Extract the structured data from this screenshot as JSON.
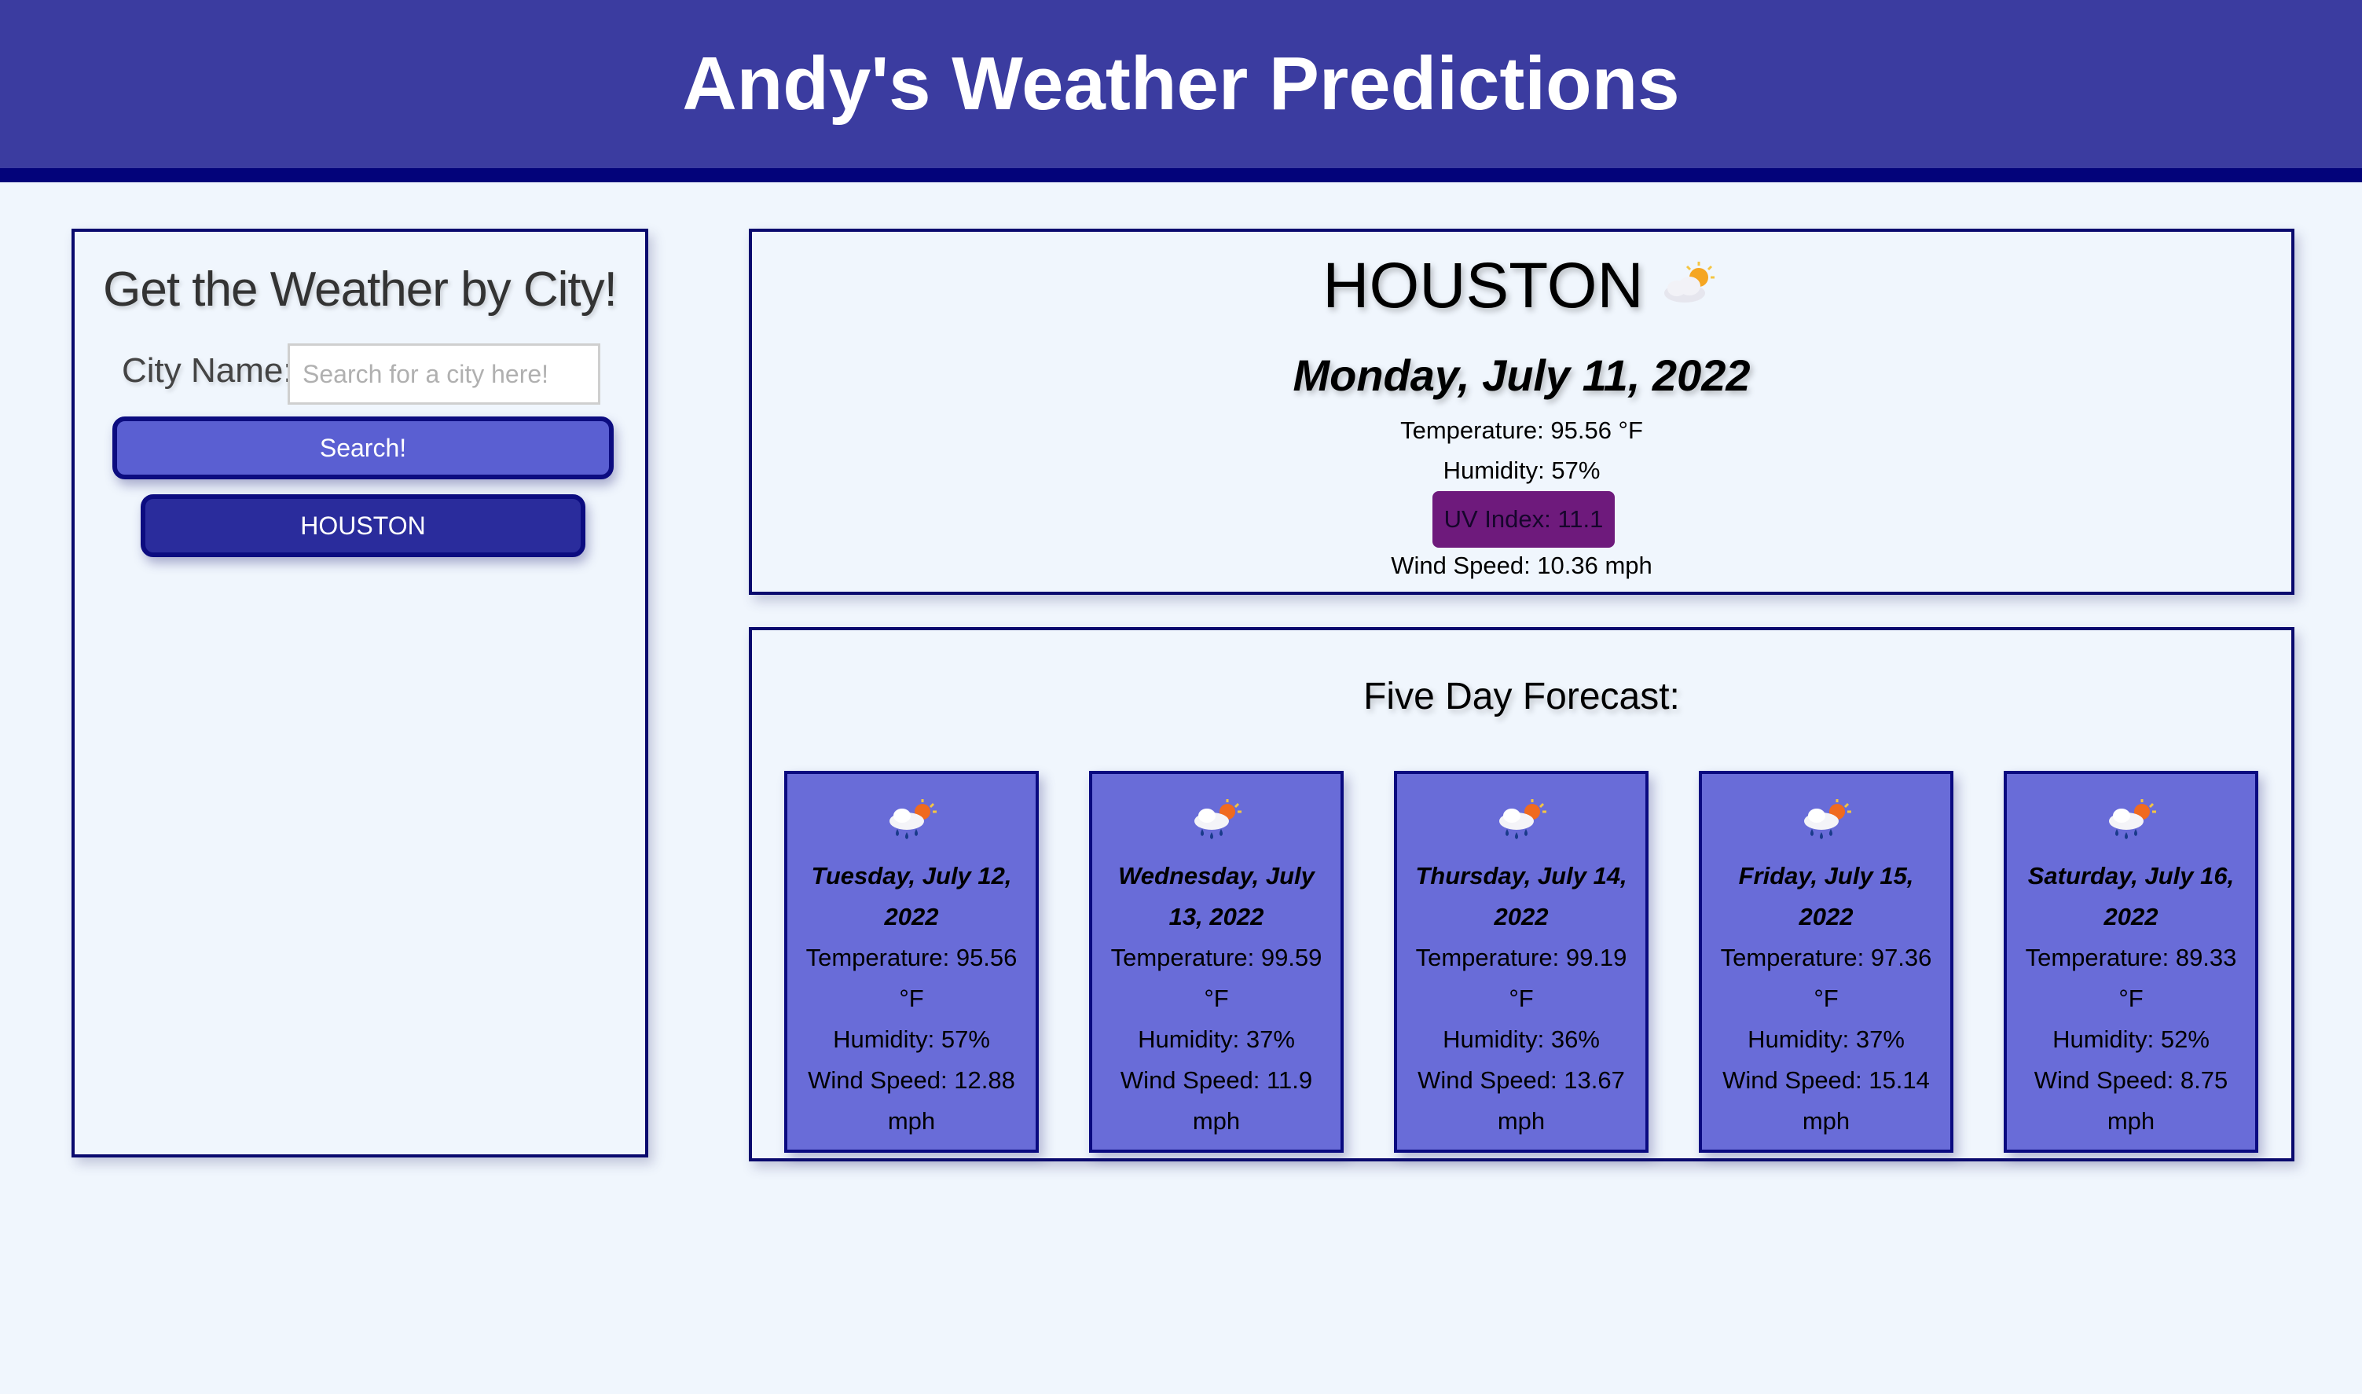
{
  "header": {
    "title": "Andy's Weather Predictions"
  },
  "search": {
    "title": "Get the Weather by City!",
    "city_label": "City Name:",
    "placeholder": "Search for a city here!",
    "value": "",
    "button_label": "Search!",
    "history": [
      "HOUSTON"
    ]
  },
  "current": {
    "city": "HOUSTON",
    "icon": "partly-cloudy-icon",
    "date": "Monday, July 11, 2022",
    "temperature": "Temperature: 95.56 °F",
    "humidity": "Humidity: 57%",
    "uv_index": "UV Index: 11.1",
    "wind": "Wind Speed: 10.36 mph",
    "uv_color": "#6e1a7c"
  },
  "forecast": {
    "title": "Five Day Forecast:",
    "days": [
      {
        "date": "Tuesday, July 12, 2022",
        "icon": "rain-sun-icon",
        "temperature": "Temperature: 95.56 °F",
        "humidity": "Humidity: 57%",
        "wind": "Wind Speed: 12.88 mph"
      },
      {
        "date": "Wednesday, July 13, 2022",
        "icon": "rain-sun-icon",
        "temperature": "Temperature: 99.59 °F",
        "humidity": "Humidity: 37%",
        "wind": "Wind Speed: 11.9 mph"
      },
      {
        "date": "Thursday, July 14, 2022",
        "icon": "rain-sun-icon",
        "temperature": "Temperature: 99.19 °F",
        "humidity": "Humidity: 36%",
        "wind": "Wind Speed: 13.67 mph"
      },
      {
        "date": "Friday, July 15, 2022",
        "icon": "rain-sun-icon",
        "temperature": "Temperature: 97.36 °F",
        "humidity": "Humidity: 37%",
        "wind": "Wind Speed: 15.14 mph"
      },
      {
        "date": "Saturday, July 16, 2022",
        "icon": "rain-sun-icon",
        "temperature": "Temperature: 89.33 °F",
        "humidity": "Humidity: 52%",
        "wind": "Wind Speed: 8.75 mph"
      }
    ]
  },
  "colors": {
    "header_bg": "#3b3ca0",
    "header_border": "#03037a",
    "page_bg": "#f0f6fd",
    "card_bg": "#696cd8",
    "search_button": "#5a5fd2",
    "history_button": "#2a2c9c"
  }
}
